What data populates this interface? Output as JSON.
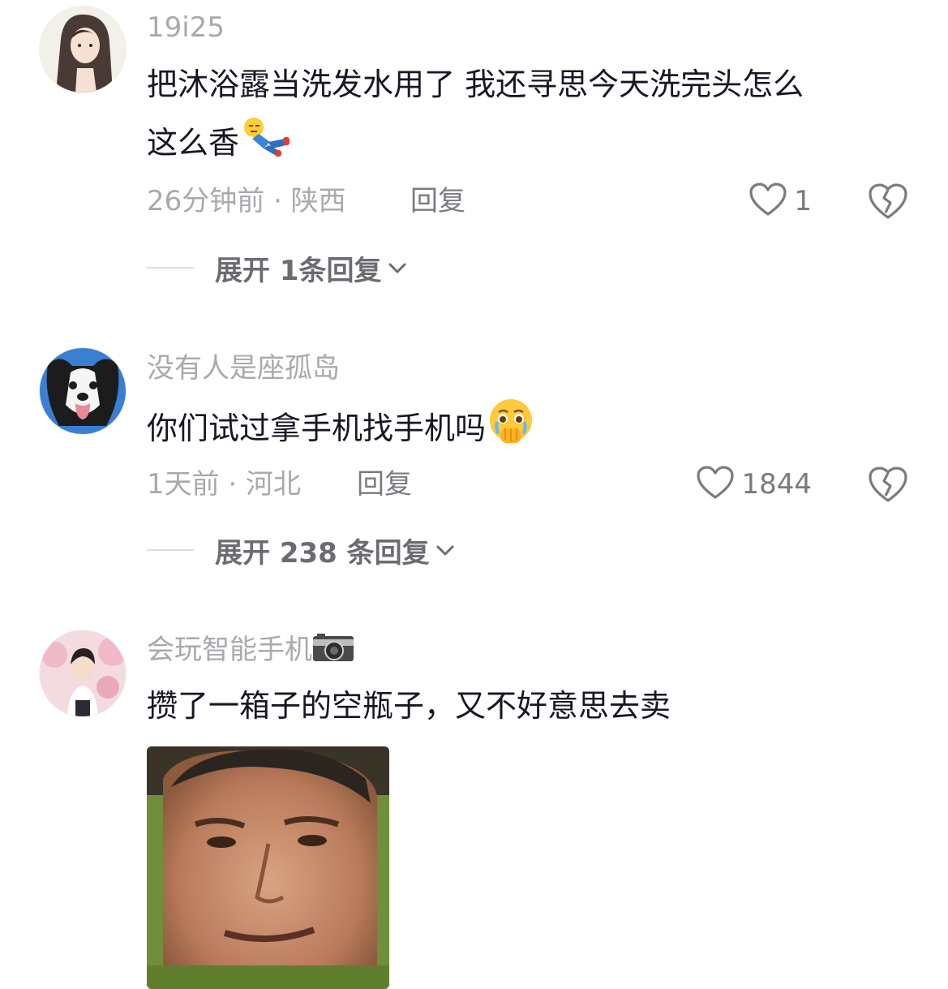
{
  "comments": [
    {
      "username": "19i25",
      "text_line1": "把沐浴露当洗发水用了 我还寻思今天洗完头怎么",
      "text_line2": "这么香",
      "emoji": "lying-down-emoji",
      "time_location": "26分钟前 · 陕西",
      "reply_label": "回复",
      "likes": "1",
      "expand_label": "展开 1条回复"
    },
    {
      "username": "没有人是座孤岛",
      "text": "你们试过拿手机找手机吗",
      "emoji": "crying-covering-mouth-emoji",
      "time_location": "1天前 · 河北",
      "reply_label": "回复",
      "likes": "1844",
      "expand_label": "展开 238 条回复"
    },
    {
      "username": "会玩智能手机",
      "username_icon": "camera-icon",
      "text": "攒了一箱子的空瓶子，又不好意思去卖",
      "image": "meme-face-image"
    }
  ],
  "colors": {
    "text": "#161823",
    "secondary": "#a9a9ae",
    "action": "#7a7b80"
  }
}
